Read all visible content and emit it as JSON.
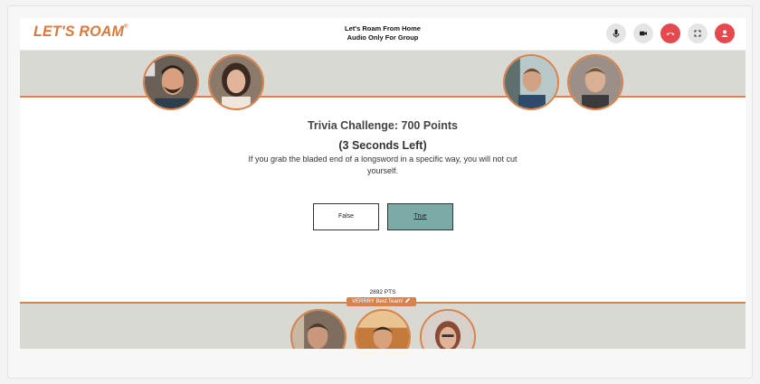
{
  "header": {
    "logo_text": "LET'S ROAM",
    "title_line1": "Let's Roam From Home",
    "title_line2": "Audio Only For Group",
    "controls": [
      {
        "icon": "microphone-icon"
      },
      {
        "icon": "camera-icon"
      },
      {
        "icon": "hang-up-icon"
      },
      {
        "icon": "fullscreen-icon"
      },
      {
        "icon": "user-icon"
      }
    ]
  },
  "question": {
    "title": "Trivia Challenge: 700 Points",
    "timer": "(3 Seconds Left)",
    "text": "If you grab the bladed end of a longsword in a specific way, you will not cut yourself.",
    "answers": [
      "False",
      "True"
    ]
  },
  "team": {
    "points": "2892 PTS",
    "name": "VERRRY Best Team!"
  },
  "colors": {
    "brand": "#d97a3c",
    "strip": "#d9d9d4",
    "answer_selected": "#7aaba7",
    "hangup": "#e5484d"
  }
}
